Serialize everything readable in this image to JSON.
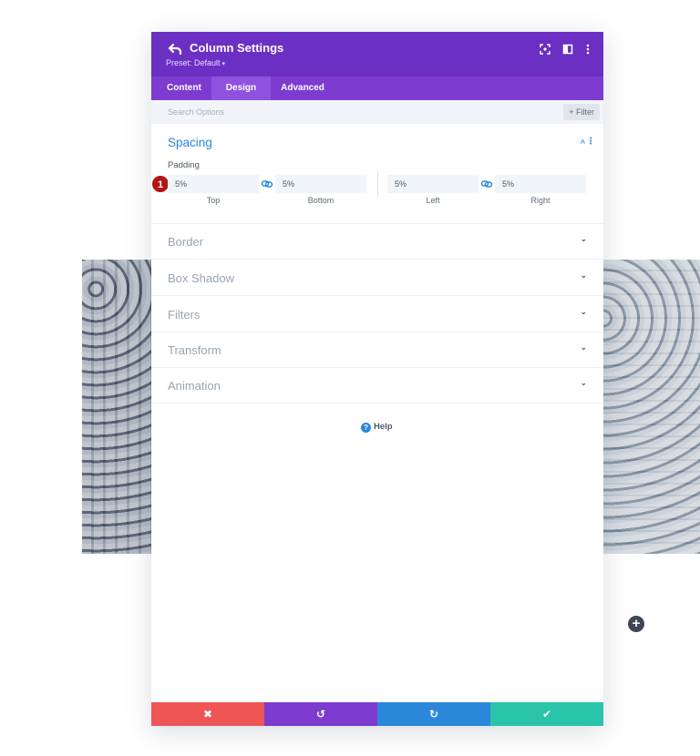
{
  "modal": {
    "title": "Column Settings",
    "preset": "Preset: Default",
    "preset_caret": "▾"
  },
  "tabs": [
    "Content",
    "Design",
    "Advanced"
  ],
  "active_tab": "Design",
  "search": {
    "placeholder": "Search Options",
    "filter_label": "+ Filter"
  },
  "spacing": {
    "title": "Spacing",
    "padding_label": "Padding",
    "fields": [
      {
        "value": "5%",
        "caption": "Top"
      },
      {
        "value": "5%",
        "caption": "Bottom"
      },
      {
        "value": "5%",
        "caption": "Left"
      },
      {
        "value": "5%",
        "caption": "Right"
      }
    ],
    "marker": "1"
  },
  "sections": [
    "Border",
    "Box Shadow",
    "Filters",
    "Transform",
    "Animation"
  ],
  "help_label": "Help",
  "footer": {
    "cancel": "✖",
    "undo": "↺",
    "redo": "↻",
    "save": "✔"
  },
  "colors": {
    "header": "#6b2fc4",
    "tabs": "#7e3bd0",
    "accent_blue": "#2b87da",
    "cancel": "#ef5555",
    "save": "#29c4a9"
  },
  "add_icon": "+"
}
